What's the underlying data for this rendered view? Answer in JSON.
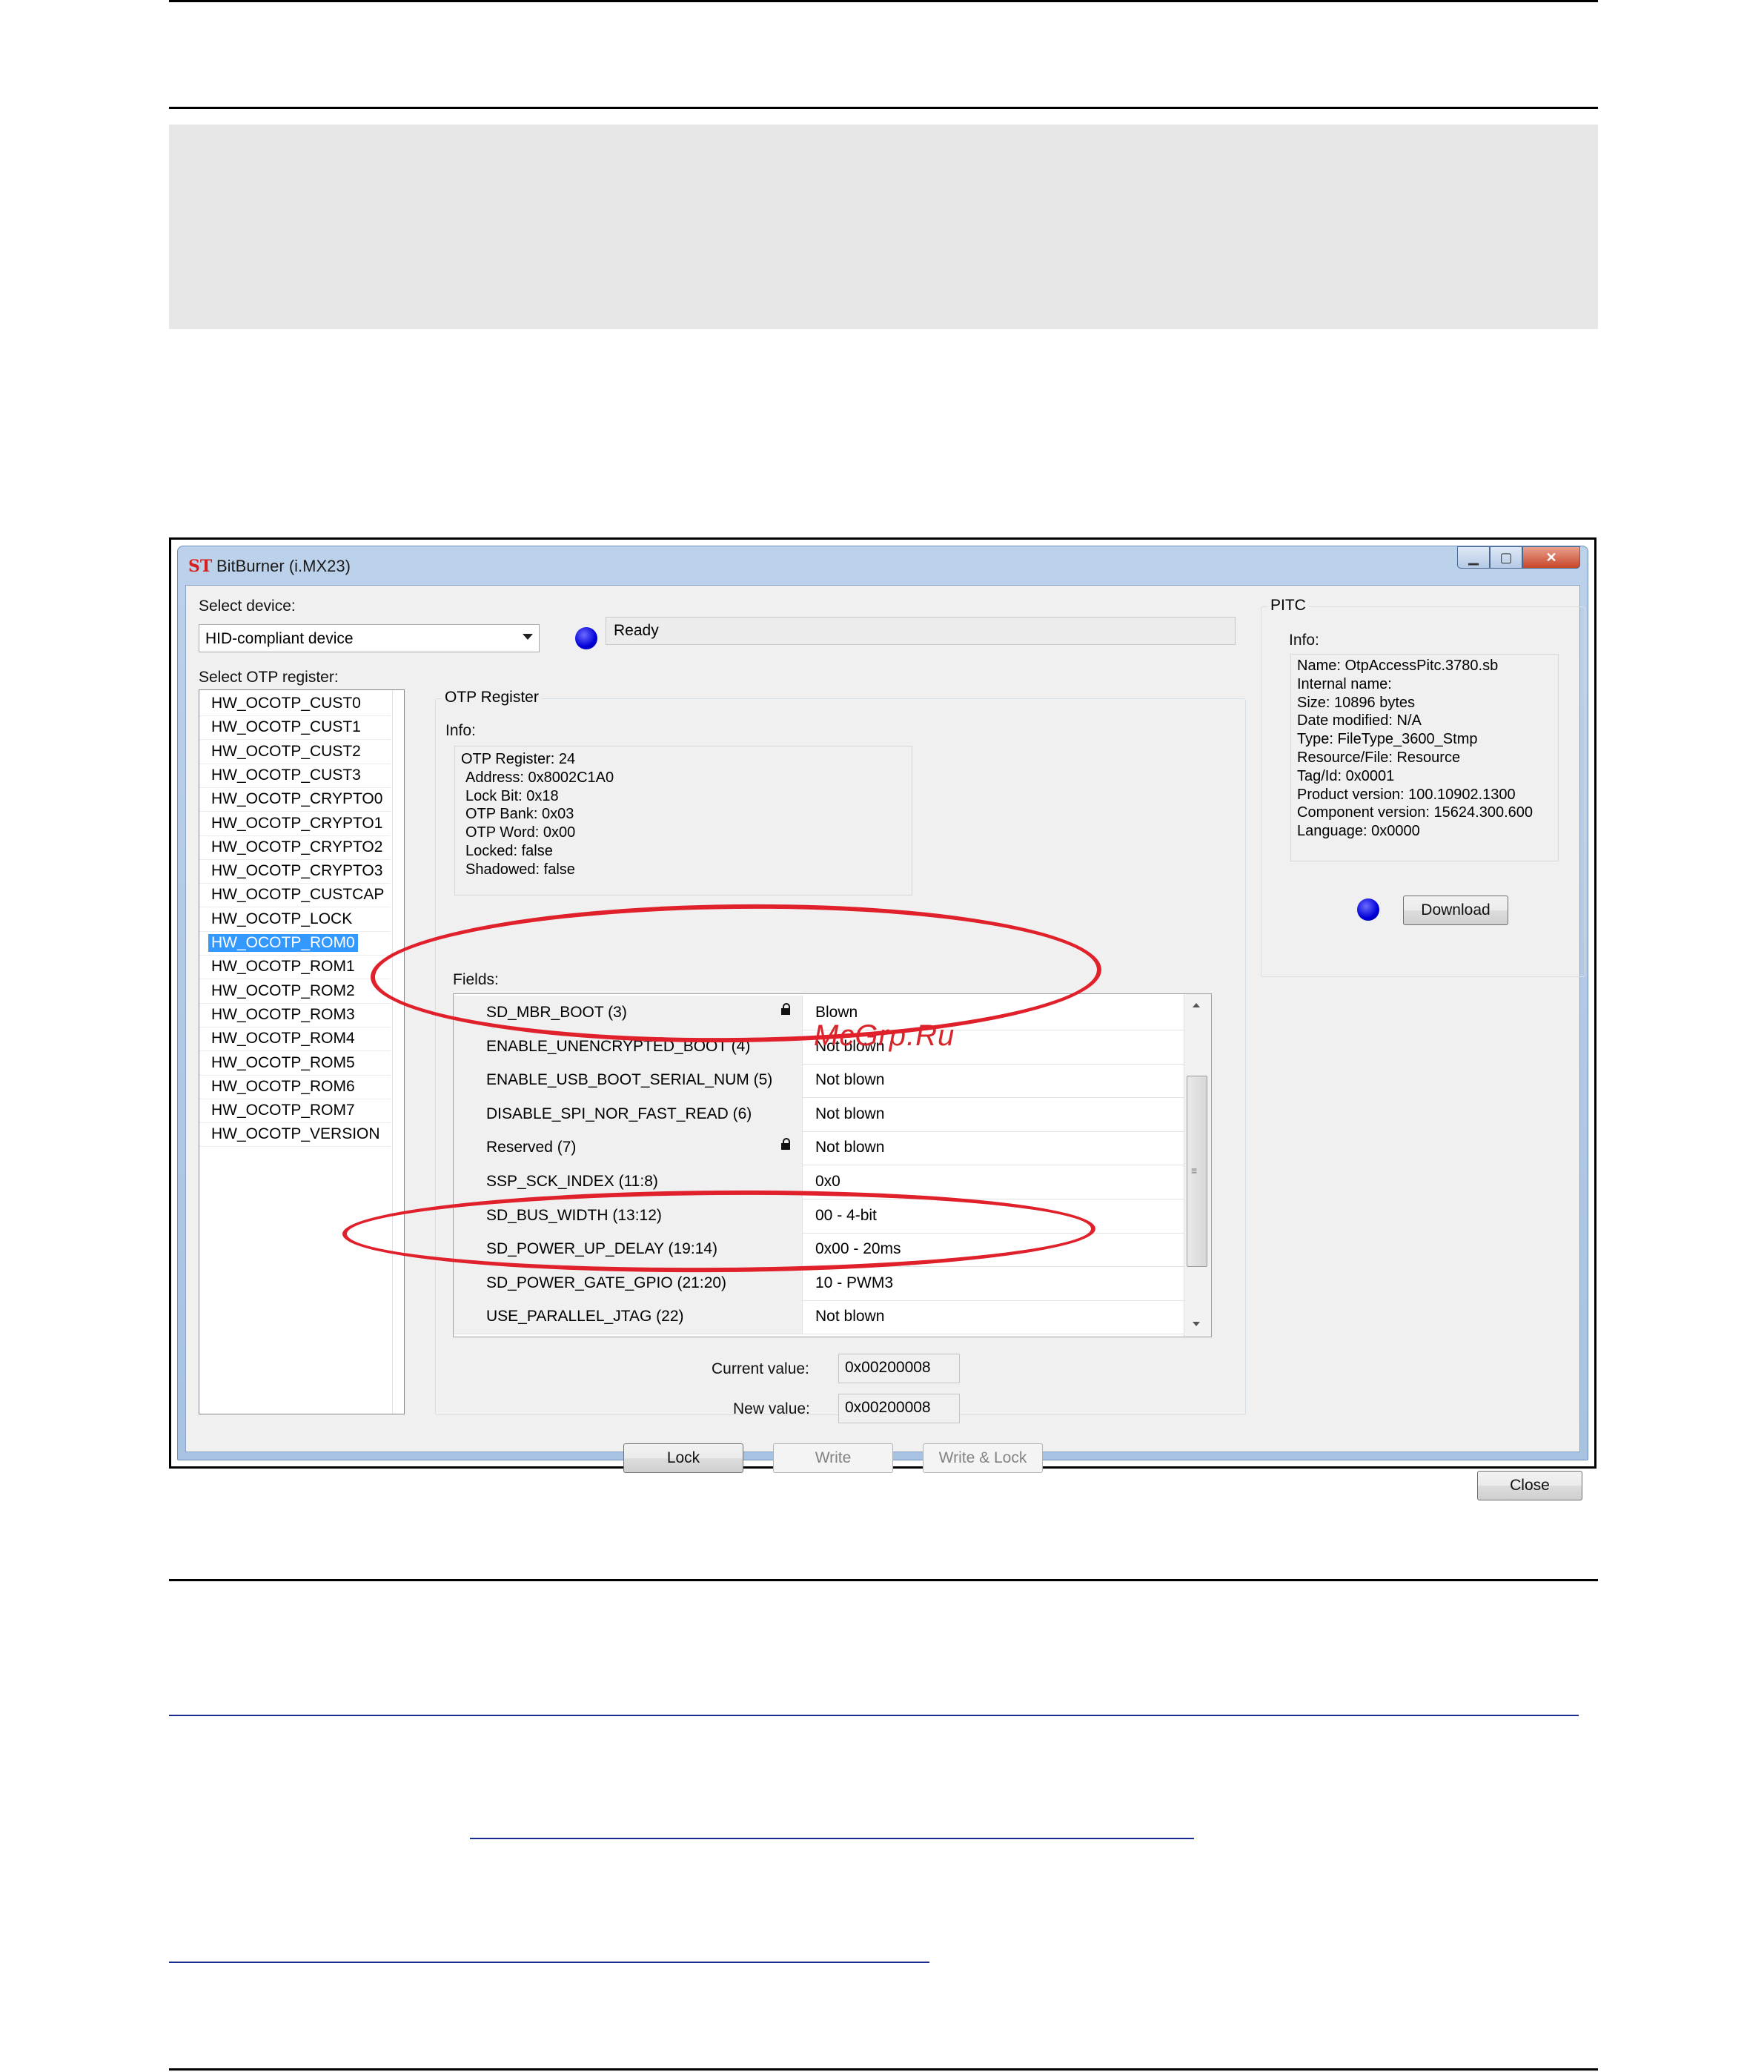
{
  "window": {
    "title": "BitBurner (i.MX23)",
    "logo_text": "ST",
    "caption_buttons": {
      "minimize": "▁",
      "maximize": "▢",
      "close": "✕"
    }
  },
  "device": {
    "label": "Select device:",
    "selected": "HID-compliant device",
    "status": "Ready",
    "status_led_color": "#0000d8"
  },
  "otp_list": {
    "label": "Select OTP register:",
    "items": [
      "HW_OCOTP_CUST0",
      "HW_OCOTP_CUST1",
      "HW_OCOTP_CUST2",
      "HW_OCOTP_CUST3",
      "HW_OCOTP_CRYPTO0",
      "HW_OCOTP_CRYPTO1",
      "HW_OCOTP_CRYPTO2",
      "HW_OCOTP_CRYPTO3",
      "HW_OCOTP_CUSTCAP",
      "HW_OCOTP_LOCK",
      "HW_OCOTP_ROM0",
      "HW_OCOTP_ROM1",
      "HW_OCOTP_ROM2",
      "HW_OCOTP_ROM3",
      "HW_OCOTP_ROM4",
      "HW_OCOTP_ROM5",
      "HW_OCOTP_ROM6",
      "HW_OCOTP_ROM7",
      "HW_OCOTP_VERSION"
    ],
    "selected": "HW_OCOTP_ROM0"
  },
  "otp_register": {
    "group_title": "OTP Register",
    "info_label": "Info:",
    "info_lines": [
      "OTP Register: 24",
      "Address: 0x8002C1A0",
      "Lock Bit: 0x18",
      "OTP Bank: 0x03",
      "OTP Word: 0x00",
      "Locked: false",
      "Shadowed: false"
    ],
    "fields_label": "Fields:",
    "fields": [
      {
        "name": "SD_MBR_BOOT (3)",
        "value": "Blown",
        "locked": true
      },
      {
        "name": "ENABLE_UNENCRYPTED_BOOT (4)",
        "value": "Not blown",
        "locked": false
      },
      {
        "name": "ENABLE_USB_BOOT_SERIAL_NUM (5)",
        "value": "Not blown",
        "locked": false
      },
      {
        "name": "DISABLE_SPI_NOR_FAST_READ (6)",
        "value": "Not blown",
        "locked": false
      },
      {
        "name": "Reserved (7)",
        "value": "Not blown",
        "locked": true
      },
      {
        "name": "SSP_SCK_INDEX (11:8)",
        "value": "0x0",
        "locked": false
      },
      {
        "name": "SD_BUS_WIDTH (13:12)",
        "value": "00 - 4-bit",
        "locked": false
      },
      {
        "name": "SD_POWER_UP_DELAY (19:14)",
        "value": "0x00 - 20ms",
        "locked": false
      },
      {
        "name": "SD_POWER_GATE_GPIO (21:20)",
        "value": "10 - PWM3",
        "locked": false
      },
      {
        "name": "USE_PARALLEL_JTAG (22)",
        "value": "Not blown",
        "locked": false
      }
    ],
    "current_value_label": "Current value:",
    "current_value": "0x00200008",
    "new_value_label": "New value:",
    "new_value": "0x00200008",
    "buttons": {
      "lock": "Lock",
      "write": "Write",
      "write_lock": "Write & Lock"
    }
  },
  "pitc": {
    "group_title": "PITC",
    "info_label": "Info:",
    "info_lines": [
      "Name: OtpAccessPitc.3780.sb",
      "Internal name:",
      "Size: 10896 bytes",
      "Date modified: N/A",
      "Type: FileType_3600_Stmp",
      "Resource/File: Resource",
      "Tag/Id: 0x0001",
      "Product version: 100.10902.1300",
      "Component version: 15624.300.600",
      "Language: 0x0000"
    ],
    "download_label": "Download"
  },
  "close_label": "Close",
  "watermark": "McGrp.Ru",
  "annotation_color": "#e0202a"
}
